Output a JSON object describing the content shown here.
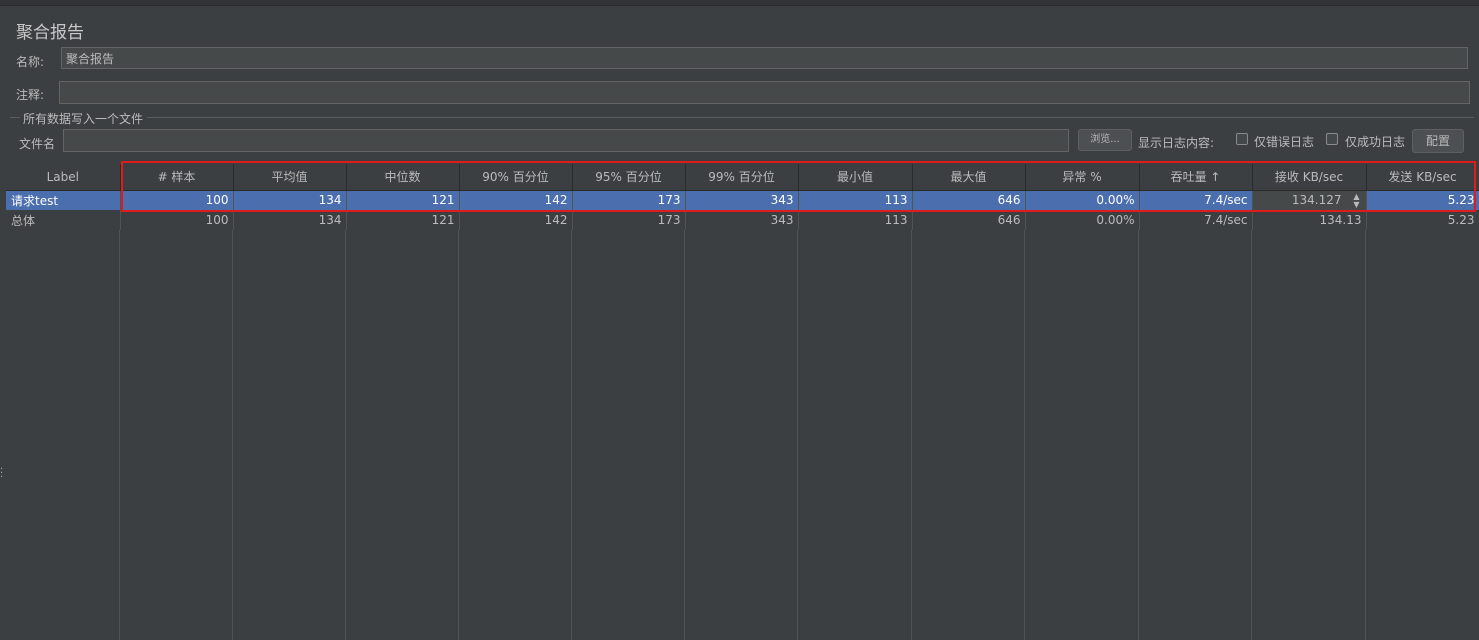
{
  "window": {
    "title": "聚合报告"
  },
  "form": {
    "name_label": "名称:",
    "name_value": "聚合报告",
    "comment_label": "注释:",
    "comment_value": "",
    "group_title": "所有数据写入一个文件",
    "file_label": "文件名",
    "file_value": "",
    "browse_label": "浏览...",
    "log_content_label": "显示日志内容:",
    "errors_only_label": "仅错误日志",
    "errors_only_checked": false,
    "success_only_label": "仅成功日志",
    "success_only_checked": false,
    "configure_label": "配置"
  },
  "table": {
    "columns": [
      "Label",
      "# 样本",
      "平均值",
      "中位数",
      "90% 百分位",
      "95% 百分位",
      "99% 百分位",
      "最小值",
      "最大值",
      "异常 %",
      "吞吐量 ↑",
      "接收 KB/sec",
      "发送 KB/sec"
    ],
    "rows": [
      [
        "请求test",
        "100",
        "134",
        "121",
        "142",
        "173",
        "343",
        "113",
        "646",
        "0.00%",
        "7.4/sec",
        "134.127",
        "5.23"
      ],
      [
        "总体",
        "100",
        "134",
        "121",
        "142",
        "173",
        "343",
        "113",
        "646",
        "0.00%",
        "7.4/sec",
        "134.13",
        "5.23"
      ]
    ],
    "selected_row": 0,
    "editing_column": 11
  },
  "colors": {
    "background": "#3c3f41",
    "selection": "#4b6eaf",
    "highlight_box": "#e01b1b"
  }
}
